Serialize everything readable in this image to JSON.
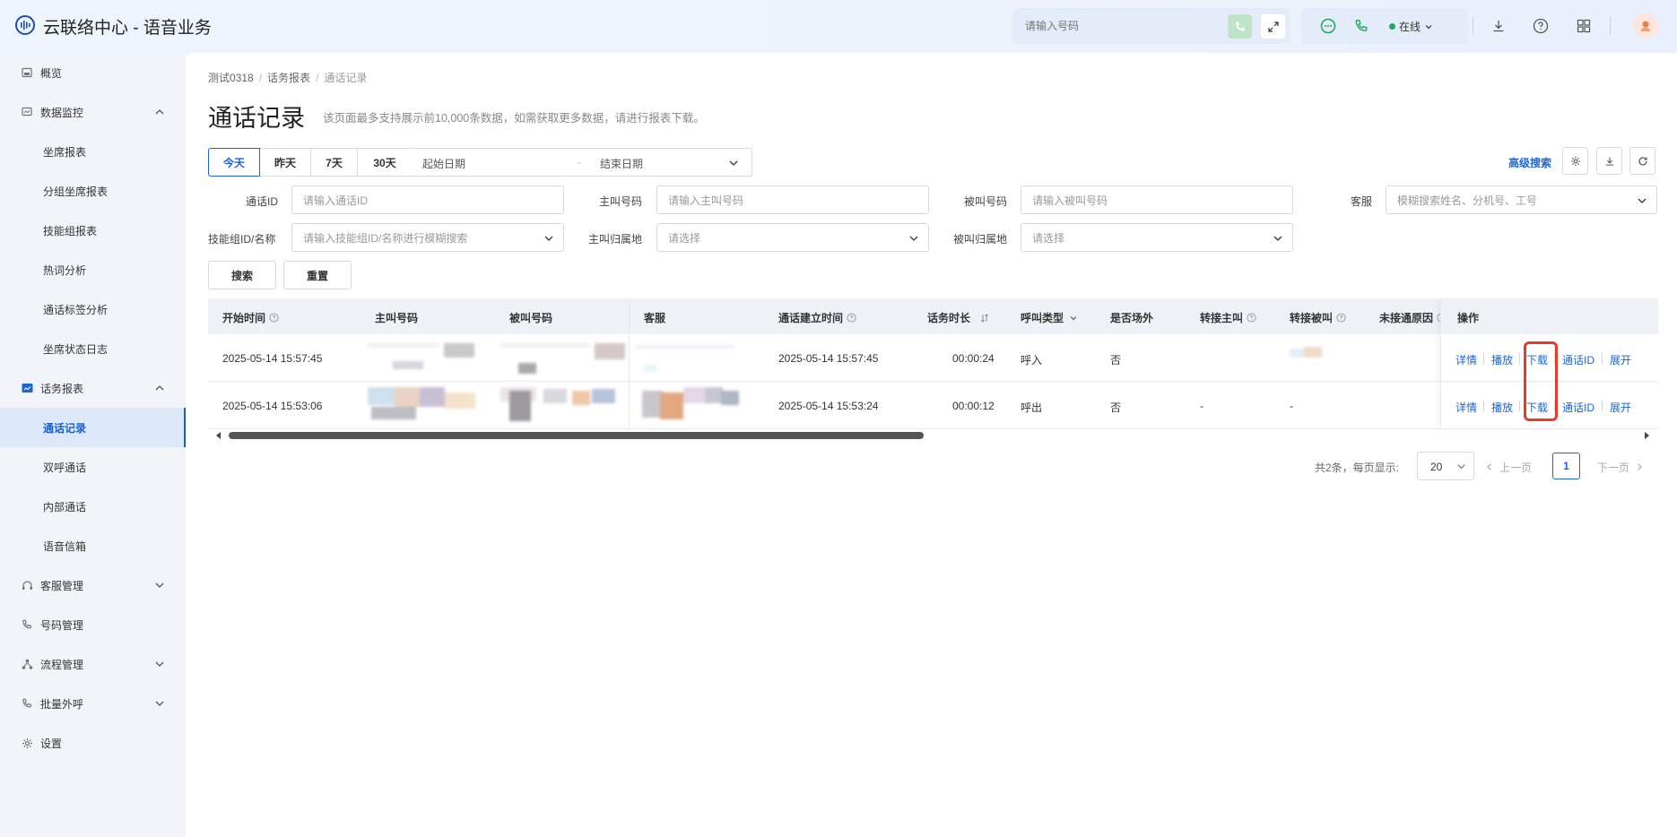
{
  "app": {
    "title": "云联络中心 - 语音业务"
  },
  "topbar": {
    "phone_placeholder": "请输入号码",
    "status_label": "在线",
    "colors": {
      "online_dot": "#1aaa55",
      "accent": "#1a66d6"
    }
  },
  "sidebar": {
    "items": [
      {
        "label": "概览",
        "icon": "overview-icon"
      },
      {
        "label": "数据监控",
        "icon": "monitor-icon"
      },
      {
        "label": "坐席报表"
      },
      {
        "label": "分组坐席报表"
      },
      {
        "label": "技能组报表"
      },
      {
        "label": "热词分析"
      },
      {
        "label": "通话标签分析"
      },
      {
        "label": "坐席状态日志"
      },
      {
        "label": "话务报表",
        "icon": "report-icon"
      },
      {
        "label": "通话记录"
      },
      {
        "label": "双呼通话"
      },
      {
        "label": "内部通话"
      },
      {
        "label": "语音信箱"
      },
      {
        "label": "客服管理",
        "icon": "headset-icon"
      },
      {
        "label": "号码管理",
        "icon": "phone-icon"
      },
      {
        "label": "流程管理",
        "icon": "flow-icon"
      },
      {
        "label": "批量外呼",
        "icon": "outbound-icon"
      },
      {
        "label": "设置",
        "icon": "gear-icon"
      }
    ]
  },
  "breadcrumb": {
    "items": [
      "测试0318",
      "话务报表",
      "通话记录"
    ],
    "separator": "/"
  },
  "page": {
    "title": "通话记录",
    "subtitle": "该页面最多支持展示前10,000条数据，如需获取更多数据，请进行报表下载。"
  },
  "date_filter": {
    "quick": [
      "今天",
      "昨天",
      "7天",
      "30天"
    ],
    "selected": "今天",
    "start_placeholder": "起始日期",
    "range_sep": "-",
    "end_placeholder": "结束日期"
  },
  "toolbar": {
    "advanced_search": "高级搜索"
  },
  "filters": {
    "call_id": {
      "label": "通话ID",
      "placeholder": "请输入通话ID"
    },
    "caller": {
      "label": "主叫号码",
      "placeholder": "请输入主叫号码"
    },
    "callee": {
      "label": "被叫号码",
      "placeholder": "请输入被叫号码"
    },
    "agent": {
      "label": "客服",
      "placeholder": "模糊搜索姓名、分机号、工号"
    },
    "skill_group": {
      "label": "技能组ID/名称",
      "placeholder": "请输入技能组ID/名称进行模糊搜索"
    },
    "caller_region": {
      "label": "主叫归属地",
      "placeholder": "请选择"
    },
    "callee_region": {
      "label": "被叫归属地",
      "placeholder": "请选择"
    },
    "search_btn": "搜索",
    "reset_btn": "重置"
  },
  "table": {
    "columns": [
      "开始时间",
      "主叫号码",
      "被叫号码",
      "客服",
      "通话建立时间",
      "话务时长",
      "呼叫类型",
      "是否场外",
      "转接主叫",
      "转接被叫",
      "未接通原因",
      "操作"
    ],
    "rows": [
      {
        "start": "2025-05-14 15:57:45",
        "connect": "2025-05-14 15:57:45",
        "duration": "00:00:24",
        "type": "呼入",
        "offsite": "否",
        "transfer_caller": "",
        "transfer_callee": ""
      },
      {
        "start": "2025-05-14 15:53:06",
        "connect": "2025-05-14 15:53:24",
        "duration": "00:00:12",
        "type": "呼出",
        "offsite": "否",
        "transfer_caller": "-",
        "transfer_callee": "-"
      }
    ],
    "actions": [
      "详情",
      "播放",
      "下载",
      "通话ID",
      "展开"
    ]
  },
  "pagination": {
    "total_text": "共2条，每页显示:",
    "page_size": "20",
    "prev": "上一页",
    "current": "1",
    "next": "下一页"
  }
}
